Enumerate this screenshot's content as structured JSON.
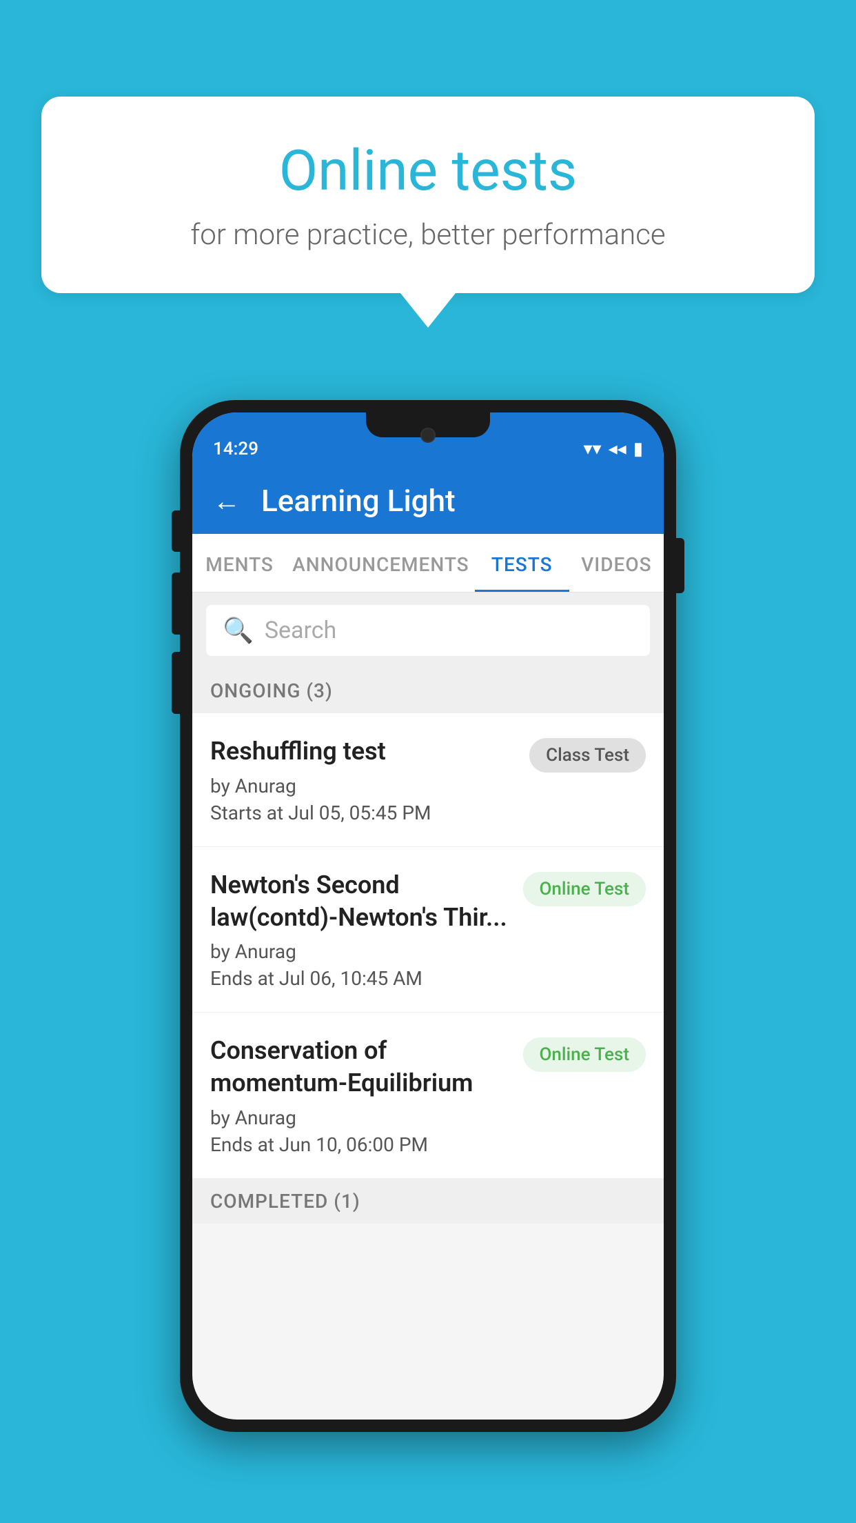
{
  "background_color": "#29b6d8",
  "speech_bubble": {
    "title": "Online tests",
    "subtitle": "for more practice, better performance"
  },
  "status_bar": {
    "time": "14:29",
    "wifi": "▼",
    "signal": "◀",
    "battery": "▮"
  },
  "app_bar": {
    "back_label": "←",
    "title": "Learning Light"
  },
  "tabs": [
    {
      "label": "MENTS",
      "active": false
    },
    {
      "label": "ANNOUNCEMENTS",
      "active": false
    },
    {
      "label": "TESTS",
      "active": true
    },
    {
      "label": "VIDEOS",
      "active": false
    }
  ],
  "search": {
    "placeholder": "Search"
  },
  "ongoing_section": {
    "label": "ONGOING (3)"
  },
  "test_items": [
    {
      "name": "Reshuffling test",
      "author": "by Anurag",
      "time_label": "Starts at",
      "time": "Jul 05, 05:45 PM",
      "badge": "Class Test",
      "badge_type": "gray"
    },
    {
      "name": "Newton's Second law(contd)-Newton's Thir...",
      "author": "by Anurag",
      "time_label": "Ends at",
      "time": "Jul 06, 10:45 AM",
      "badge": "Online Test",
      "badge_type": "green"
    },
    {
      "name": "Conservation of momentum-Equilibrium",
      "author": "by Anurag",
      "time_label": "Ends at",
      "time": "Jun 10, 06:00 PM",
      "badge": "Online Test",
      "badge_type": "green"
    }
  ],
  "completed_section": {
    "label": "COMPLETED (1)"
  }
}
